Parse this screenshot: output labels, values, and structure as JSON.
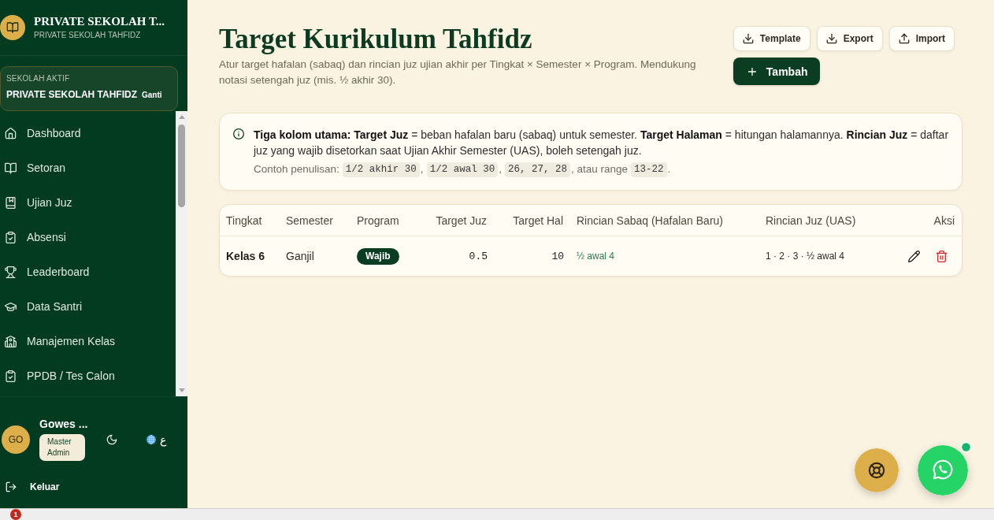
{
  "sidebar": {
    "brand": {
      "title": "PRIVATE SEKOLAH T...",
      "subtitle": "PRIVATE SEKOLAH TAHFIDZ"
    },
    "school": {
      "label": "SEKOLAH AKTIF",
      "name": "PRIVATE SEKOLAH TAHFIDZ",
      "action": "Ganti"
    },
    "nav": [
      {
        "label": "Dashboard",
        "kind": "home",
        "selected": false
      },
      {
        "label": "Setoran",
        "kind": "book-open",
        "selected": false
      },
      {
        "label": "Ujian Juz",
        "kind": "book",
        "selected": false
      },
      {
        "label": "Absensi",
        "kind": "clipboard",
        "selected": false
      },
      {
        "label": "Leaderboard",
        "kind": "trophy",
        "selected": false
      },
      {
        "label": "Data Santri",
        "kind": "graduation",
        "selected": false
      },
      {
        "label": "Manajemen Kelas",
        "kind": "school",
        "selected": false
      },
      {
        "label": "PPDB / Tes Calon",
        "kind": "clipboard",
        "selected": false
      }
    ],
    "user": {
      "initials": "GO",
      "name": "Gowes ...",
      "role": "Master Admin",
      "language": "ع"
    },
    "logout": "Keluar"
  },
  "header": {
    "title": "Target Kurikulum Tahfidz",
    "description": "Atur target hafalan (sabaq) dan rincian juz ujian akhir per Tingkat × Semester × Program. Mendukung notasi setengah juz (mis. ½ akhir 30).",
    "actions": [
      {
        "label": "Template",
        "kind": "download"
      },
      {
        "label": "Export",
        "kind": "download"
      },
      {
        "label": "Import",
        "kind": "upload"
      },
      {
        "label": "Tambah",
        "kind": "add"
      }
    ]
  },
  "info": {
    "text": "**Tiga kolom utama: Target Juz** = beban hafalan baru (sabaq) untuk semester. **Target Halaman** = hitungan halamannya. **Rincian Juz** = daftar juz yang wajib disetorkan saat Ujian Akhir Semester (UAS), boleh setengah juz.",
    "example": [
      {
        "kind": "text",
        "text": "Contoh penulisan:"
      },
      {
        "kind": "code",
        "text": "1/2 akhir 30"
      },
      {
        "kind": "text",
        "text": ","
      },
      {
        "kind": "code",
        "text": "1/2 awal 30"
      },
      {
        "kind": "text",
        "text": ","
      },
      {
        "kind": "code",
        "text": "26, 27, 28"
      },
      {
        "kind": "text",
        "text": ", atau range"
      },
      {
        "kind": "code",
        "text": "13-22"
      },
      {
        "kind": "text",
        "text": "."
      }
    ]
  },
  "table": {
    "columns": [
      {
        "label": "Tingkat",
        "kind": "title"
      },
      {
        "label": "Semester",
        "kind": "text"
      },
      {
        "label": "Program",
        "kind": "pill"
      },
      {
        "label": "Target Juz",
        "kind": "number"
      },
      {
        "label": "Target Hal",
        "kind": "number"
      },
      {
        "label": "Rincian Sabaq (Hafalan Baru)",
        "kind": "accent"
      },
      {
        "label": "Rincian Juz (UAS)",
        "kind": "detail"
      },
      {
        "label": "Aksi",
        "kind": "actions"
      }
    ],
    "rows": [
      {
        "cells": [
          "Kelas 6",
          "Ganjil",
          "Wajib",
          "0.5",
          "10",
          "½ awal 4",
          "1 · 2 · 3 · ½ awal 4"
        ]
      }
    ]
  },
  "taskbar": {
    "badge": "1"
  }
}
